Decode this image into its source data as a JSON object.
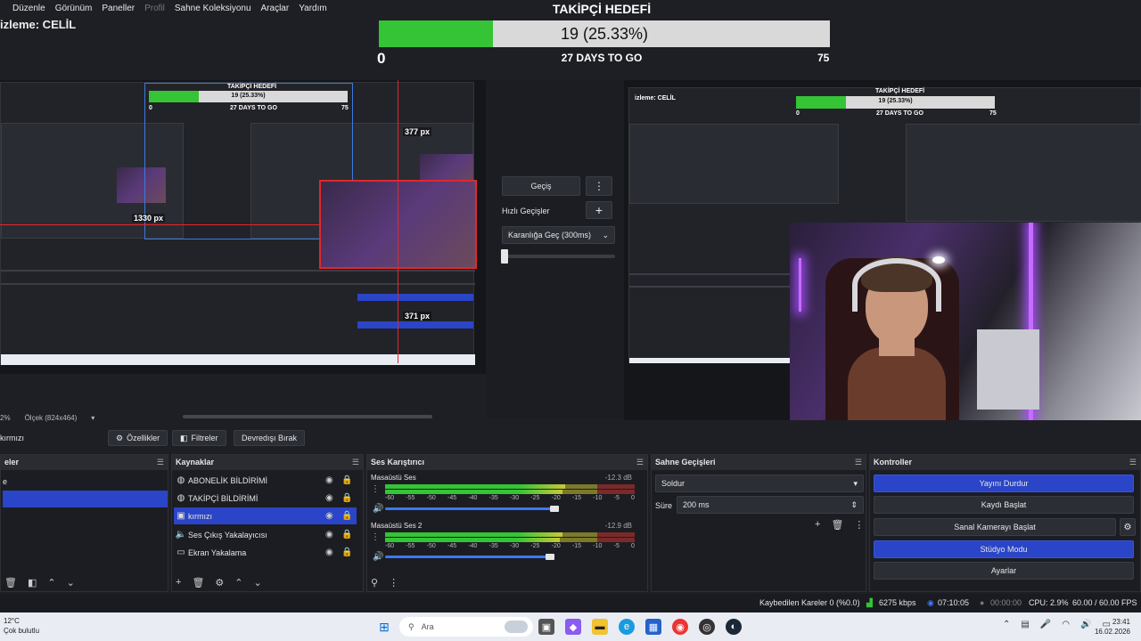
{
  "menu": [
    "Düzenle",
    "Görünüm",
    "Paneller",
    "Profil",
    "Sahne Koleksiyonu",
    "Araçlar",
    "Yardım"
  ],
  "preview_title": "izleme: CELİL",
  "goal": {
    "title": "TAKİPÇİ HEDEFİ",
    "value_text": "19 (25.33%)",
    "min": "0",
    "max": "75",
    "days": "27 DAYS TO GO",
    "progress": 0.2533
  },
  "preview": {
    "mini_title": "TAKİPÇİ HEDEFİ",
    "mini_value": "19 (25.33%)",
    "mini_days": "27 DAYS TO GO",
    "mini_min": "0",
    "mini_max": "75",
    "label_377": "377 px",
    "label_1330": "1330 px",
    "label_371": "371 px",
    "scale_text": "2%",
    "size_text": "Ölçek (824x464)"
  },
  "transitions_mid": {
    "transition_button": "Geçiş",
    "quick_label": "Hızlı Geçişler",
    "quick_select": "Karanlığa Geç (300ms)"
  },
  "program": {
    "mini_title": "TAKİPÇİ HEDEFİ",
    "mini_value": "19 (25.33%)",
    "mini_days": "27 DAYS TO GO",
    "mini_min": "0",
    "mini_max": "75",
    "mini_preview": "izleme: CELİL"
  },
  "toolbar": {
    "source_name": "kırmızı",
    "properties": "Özellikler",
    "filters": "Filtreler",
    "disable": "Devredışı Bırak"
  },
  "scenes": {
    "title": "eler",
    "items": [
      "e",
      ""
    ]
  },
  "sources": {
    "title": "Kaynaklar",
    "items": [
      {
        "label": "ABONELİK BİLDİRİMİ",
        "icon": "globe-icon"
      },
      {
        "label": "TAKİPÇİ BİLDİRİMİ",
        "icon": "globe-icon"
      },
      {
        "label": "kırmızı",
        "icon": "camera-icon"
      },
      {
        "label": "Ses Çıkış Yakalayıcısı",
        "icon": "speaker-icon"
      },
      {
        "label": "Ekran Yakalama",
        "icon": "monitor-icon"
      }
    ]
  },
  "mixer": {
    "title": "Ses Karıştırıcı",
    "channels": [
      {
        "name": "Masaüstü Ses",
        "db": "-12.3 dB",
        "level": 0.72,
        "volume": 0.68
      },
      {
        "name": "Masaüstü Ses 2",
        "db": "-12.9 dB",
        "level": 0.71,
        "volume": 0.66
      }
    ],
    "scale": [
      "-60",
      "-55",
      "-50",
      "-45",
      "-40",
      "-35",
      "-30",
      "-25",
      "-20",
      "-15",
      "-10",
      "-5",
      "0"
    ]
  },
  "scene_transitions": {
    "title": "Sahne Geçişleri",
    "type": "Soldur",
    "duration_label": "Süre",
    "duration": "200 ms"
  },
  "controls": {
    "title": "Kontroller",
    "buttons": [
      "Yayını Durdur",
      "Kaydı Başlat",
      "Sanal Kamerayı Başlat",
      "Stüdyo Modu",
      "Ayarlar"
    ]
  },
  "stats": {
    "dropped": "Kaybedilen Kareler 0 (%0.0)",
    "bitrate": "6275 kbps",
    "stream_time": "07:10:05",
    "rec_time": "00:00:00",
    "cpu": "CPU: 2.9%",
    "fps": "60.00 / 60.00 FPS"
  },
  "taskbar": {
    "temp": "12°C",
    "weather": "Çok bulutlu",
    "search_placeholder": "Ara",
    "time": "23:41",
    "date": "16.02.2026"
  },
  "colors": {
    "accent_blue": "#2a45c7",
    "goal_green": "#35c436",
    "selection_red": "#e0282c"
  }
}
